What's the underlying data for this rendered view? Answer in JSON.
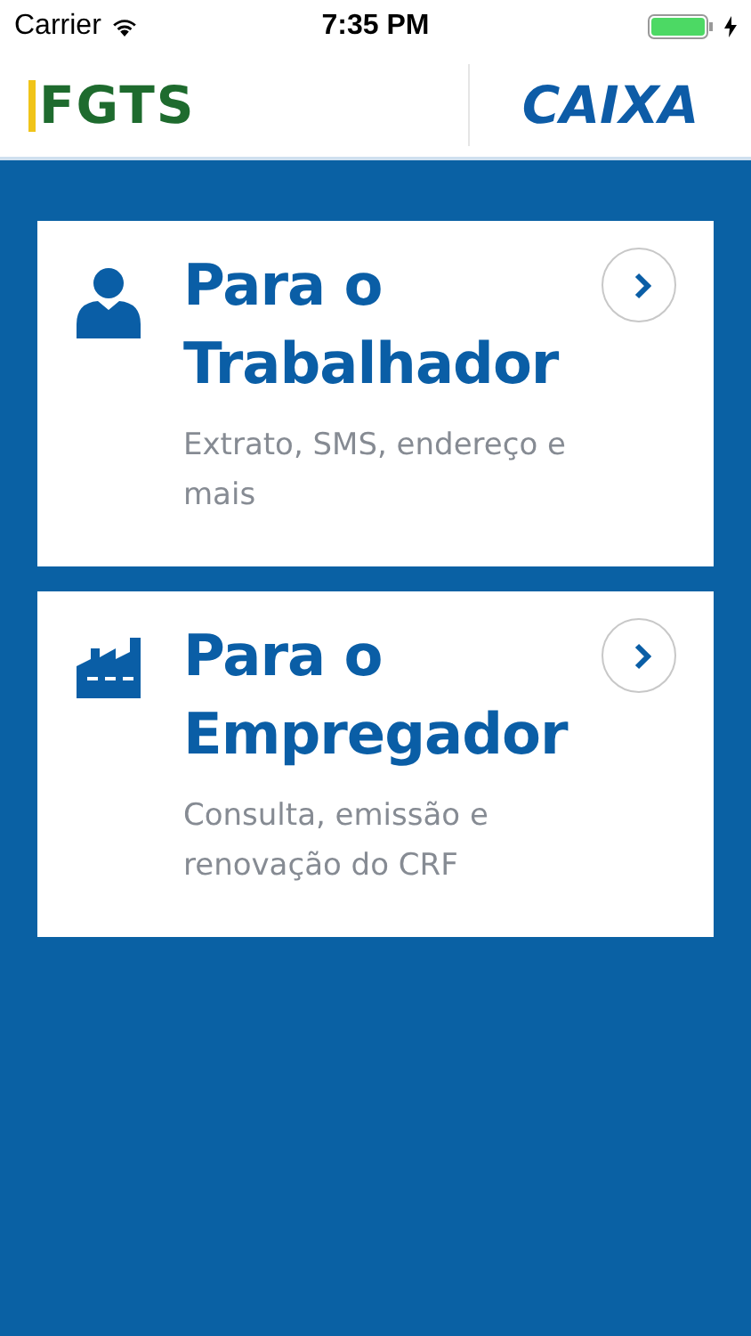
{
  "status_bar": {
    "carrier": "Carrier",
    "time": "7:35 PM"
  },
  "header": {
    "left_logo": "FGTS",
    "right_logo": "CAIXA"
  },
  "cards": [
    {
      "kind": "person",
      "title": "Para o Trabalhador",
      "subtitle": "Extrato, SMS, endereço e mais"
    },
    {
      "kind": "factory",
      "title": "Para o Empregador",
      "subtitle": "Consulta, emissão e renovação do CRF"
    }
  ]
}
